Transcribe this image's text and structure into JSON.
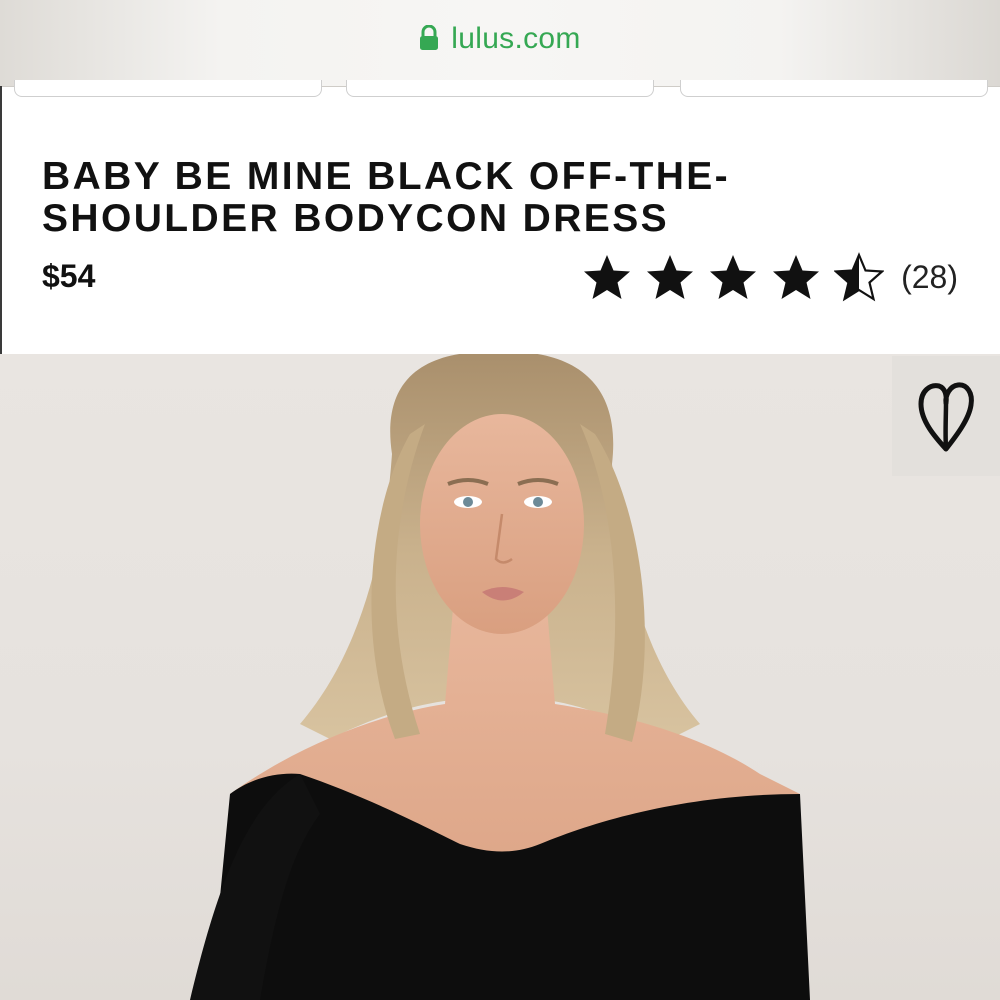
{
  "browser": {
    "url": "lulus.com",
    "lock_icon": "lock-icon",
    "accent_color": "#35a853"
  },
  "product": {
    "title_line1": "BABY BE MINE BLACK OFF-THE-",
    "title_line2": "SHOULDER BODYCON DRESS",
    "price": "$54",
    "rating": 4.5,
    "rating_max": 5,
    "review_count": "(28)"
  },
  "image": {
    "alt_subject": "model wearing black off-the-shoulder dress",
    "wishlist_icon": "heart-icon"
  }
}
